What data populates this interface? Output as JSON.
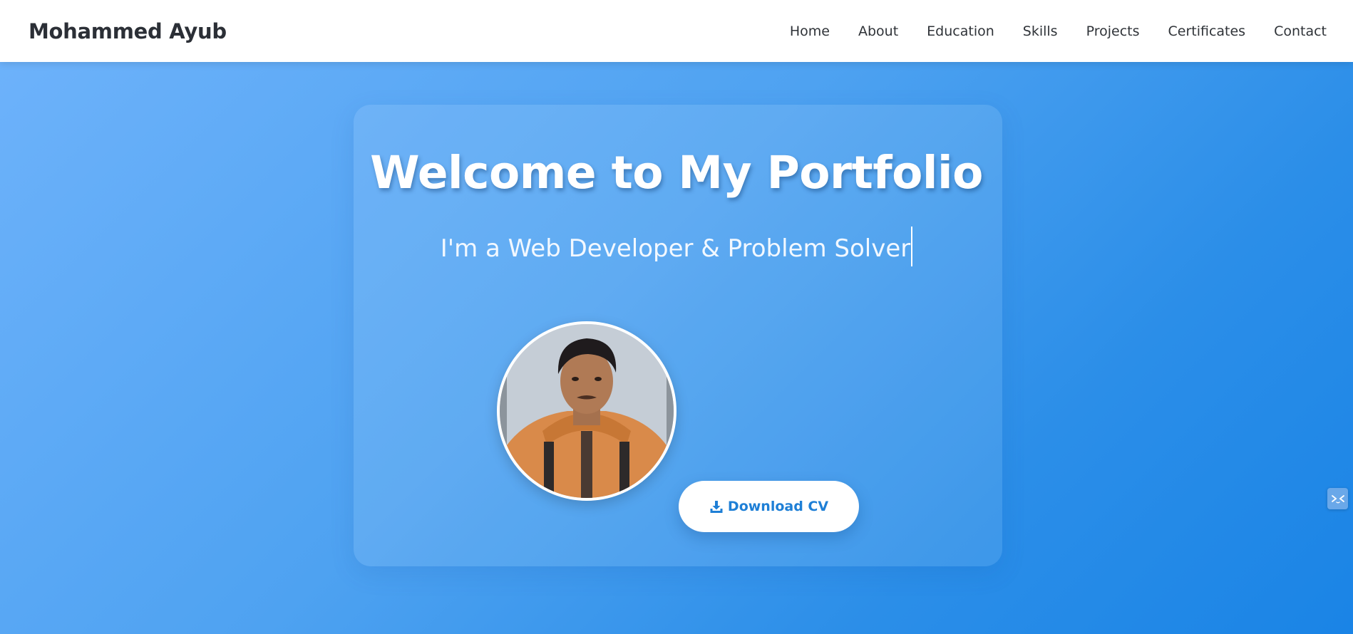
{
  "header": {
    "brand": "Mohammed Ayub",
    "nav": [
      "Home",
      "About",
      "Education",
      "Skills",
      "Projects",
      "Certificates",
      "Contact"
    ]
  },
  "hero": {
    "title": "Welcome to My Portfolio",
    "subtitle": "I'm a Web Developer & Problem Solver",
    "download_label": "Download CV",
    "download_icon": "download-icon"
  },
  "widget": {
    "icon": "code-chat-icon"
  },
  "colors": {
    "accent": "#1e7fd6",
    "background_start": "#6fb3fb",
    "background_end": "#1a84e6"
  }
}
